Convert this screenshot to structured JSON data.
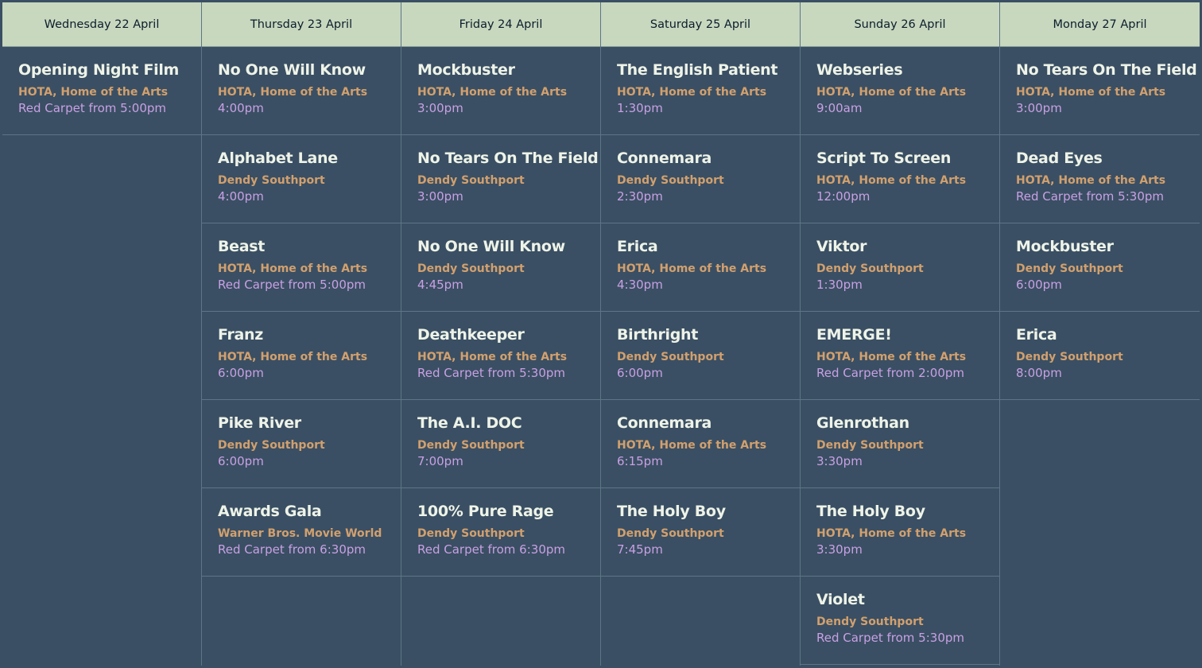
{
  "colors": {
    "background": "#3a4f63",
    "header_bg": "#c7d8bf",
    "title": "#eef3e8",
    "venue": "#d2a06e",
    "time": "#c9a0e4"
  },
  "days": [
    {
      "label": "Wednesday 22 April",
      "events": [
        {
          "title": "Opening Night Film",
          "venue": "HOTA, Home of the Arts",
          "time": "Red Carpet from 5:00pm"
        }
      ]
    },
    {
      "label": "Thursday 23 April",
      "events": [
        {
          "title": "No One Will Know",
          "venue": "HOTA, Home of the Arts",
          "time": "4:00pm"
        },
        {
          "title": "Alphabet Lane",
          "venue": "Dendy Southport",
          "time": "4:00pm"
        },
        {
          "title": "Beast",
          "venue": "HOTA, Home of the Arts",
          "time": "Red Carpet from 5:00pm"
        },
        {
          "title": "Franz",
          "venue": "HOTA, Home of the Arts",
          "time": "6:00pm"
        },
        {
          "title": "Pike River",
          "venue": "Dendy Southport",
          "time": "6:00pm"
        },
        {
          "title": "Awards Gala",
          "venue": "Warner Bros. Movie World",
          "time": "Red Carpet from 6:30pm"
        }
      ]
    },
    {
      "label": "Friday 24 April",
      "events": [
        {
          "title": "Mockbuster",
          "venue": "HOTA, Home of the Arts",
          "time": "3:00pm"
        },
        {
          "title": "No Tears On The Field",
          "venue": "Dendy Southport",
          "time": "3:00pm"
        },
        {
          "title": "No One Will Know",
          "venue": "Dendy Southport",
          "time": "4:45pm"
        },
        {
          "title": "Deathkeeper",
          "venue": "HOTA, Home of the Arts",
          "time": "Red Carpet from 5:30pm"
        },
        {
          "title": "The A.I. DOC",
          "venue": "Dendy Southport",
          "time": "7:00pm"
        },
        {
          "title": "100% Pure Rage",
          "venue": "Dendy Southport",
          "time": "Red Carpet from 6:30pm"
        }
      ]
    },
    {
      "label": "Saturday 25 April",
      "events": [
        {
          "title": "The English Patient",
          "venue": "HOTA, Home of the Arts",
          "time": "1:30pm"
        },
        {
          "title": "Connemara",
          "venue": "Dendy Southport",
          "time": "2:30pm"
        },
        {
          "title": "Erica",
          "venue": "HOTA, Home of the Arts",
          "time": "4:30pm"
        },
        {
          "title": "Birthright",
          "venue": "Dendy Southport",
          "time": "6:00pm"
        },
        {
          "title": "Connemara",
          "venue": "HOTA, Home of the Arts",
          "time": "6:15pm"
        },
        {
          "title": "The Holy Boy",
          "venue": "Dendy Southport",
          "time": "7:45pm"
        }
      ]
    },
    {
      "label": "Sunday 26 April",
      "events": [
        {
          "title": "Webseries",
          "venue": "HOTA, Home of the Arts",
          "time": "9:00am"
        },
        {
          "title": "Script To Screen",
          "venue": "HOTA, Home of the Arts",
          "time": "12:00pm"
        },
        {
          "title": "Viktor",
          "venue": "Dendy Southport",
          "time": "1:30pm"
        },
        {
          "title": "EMERGE!",
          "venue": "HOTA, Home of the Arts",
          "time": "Red Carpet from 2:00pm"
        },
        {
          "title": "Glenrothan",
          "venue": "Dendy Southport",
          "time": "3:30pm"
        },
        {
          "title": "The Holy Boy",
          "venue": "HOTA, Home of the Arts",
          "time": "3:30pm"
        },
        {
          "title": "Violet",
          "venue": "Dendy Southport",
          "time": "Red Carpet from 5:30pm"
        }
      ]
    },
    {
      "label": "Monday 27 April",
      "events": [
        {
          "title": "No Tears On The Field",
          "venue": "HOTA, Home of the Arts",
          "time": "3:00pm"
        },
        {
          "title": "Dead Eyes",
          "venue": "HOTA, Home of the Arts",
          "time": "Red Carpet from 5:30pm"
        },
        {
          "title": "Mockbuster",
          "venue": "Dendy Southport",
          "time": "6:00pm"
        },
        {
          "title": "Erica",
          "venue": "Dendy Southport",
          "time": "8:00pm"
        }
      ]
    }
  ]
}
